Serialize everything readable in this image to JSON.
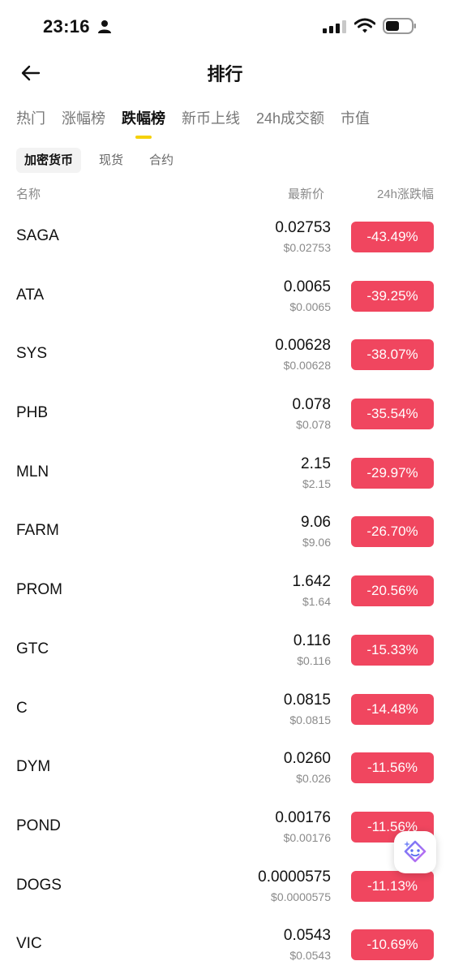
{
  "status_bar": {
    "time": "23:16"
  },
  "header": {
    "title": "排行"
  },
  "tabs": [
    {
      "label": "热门",
      "active": false
    },
    {
      "label": "涨幅榜",
      "active": false
    },
    {
      "label": "跌幅榜",
      "active": true
    },
    {
      "label": "新币上线",
      "active": false
    },
    {
      "label": "24h成交额",
      "active": false
    },
    {
      "label": "市值",
      "active": false
    }
  ],
  "subtabs": [
    {
      "label": "加密货币",
      "active": true
    },
    {
      "label": "现货",
      "active": false
    },
    {
      "label": "合约",
      "active": false
    }
  ],
  "columns": {
    "name": "名称",
    "price": "最新价",
    "change": "24h涨跌幅"
  },
  "rows": [
    {
      "symbol": "SAGA",
      "price": "0.02753",
      "usd": "$0.02753",
      "change": "-43.49%"
    },
    {
      "symbol": "ATA",
      "price": "0.0065",
      "usd": "$0.0065",
      "change": "-39.25%"
    },
    {
      "symbol": "SYS",
      "price": "0.00628",
      "usd": "$0.00628",
      "change": "-38.07%"
    },
    {
      "symbol": "PHB",
      "price": "0.078",
      "usd": "$0.078",
      "change": "-35.54%"
    },
    {
      "symbol": "MLN",
      "price": "2.15",
      "usd": "$2.15",
      "change": "-29.97%"
    },
    {
      "symbol": "FARM",
      "price": "9.06",
      "usd": "$9.06",
      "change": "-26.70%"
    },
    {
      "symbol": "PROM",
      "price": "1.642",
      "usd": "$1.64",
      "change": "-20.56%"
    },
    {
      "symbol": "GTC",
      "price": "0.116",
      "usd": "$0.116",
      "change": "-15.33%"
    },
    {
      "symbol": "C",
      "price": "0.0815",
      "usd": "$0.0815",
      "change": "-14.48%"
    },
    {
      "symbol": "DYM",
      "price": "0.0260",
      "usd": "$0.026",
      "change": "-11.56%"
    },
    {
      "symbol": "POND",
      "price": "0.00176",
      "usd": "$0.00176",
      "change": "-11.56%"
    },
    {
      "symbol": "DOGS",
      "price": "0.0000575",
      "usd": "$0.0000575",
      "change": "-11.13%"
    },
    {
      "symbol": "VIC",
      "price": "0.0543",
      "usd": "$0.0543",
      "change": "-10.69%"
    }
  ],
  "colors": {
    "accent": "#f5d10b",
    "down": "#f0465f",
    "muted": "#8a8a8a"
  },
  "icons": {
    "back": "arrow-left-icon",
    "assistant": "ai-assistant-icon"
  }
}
